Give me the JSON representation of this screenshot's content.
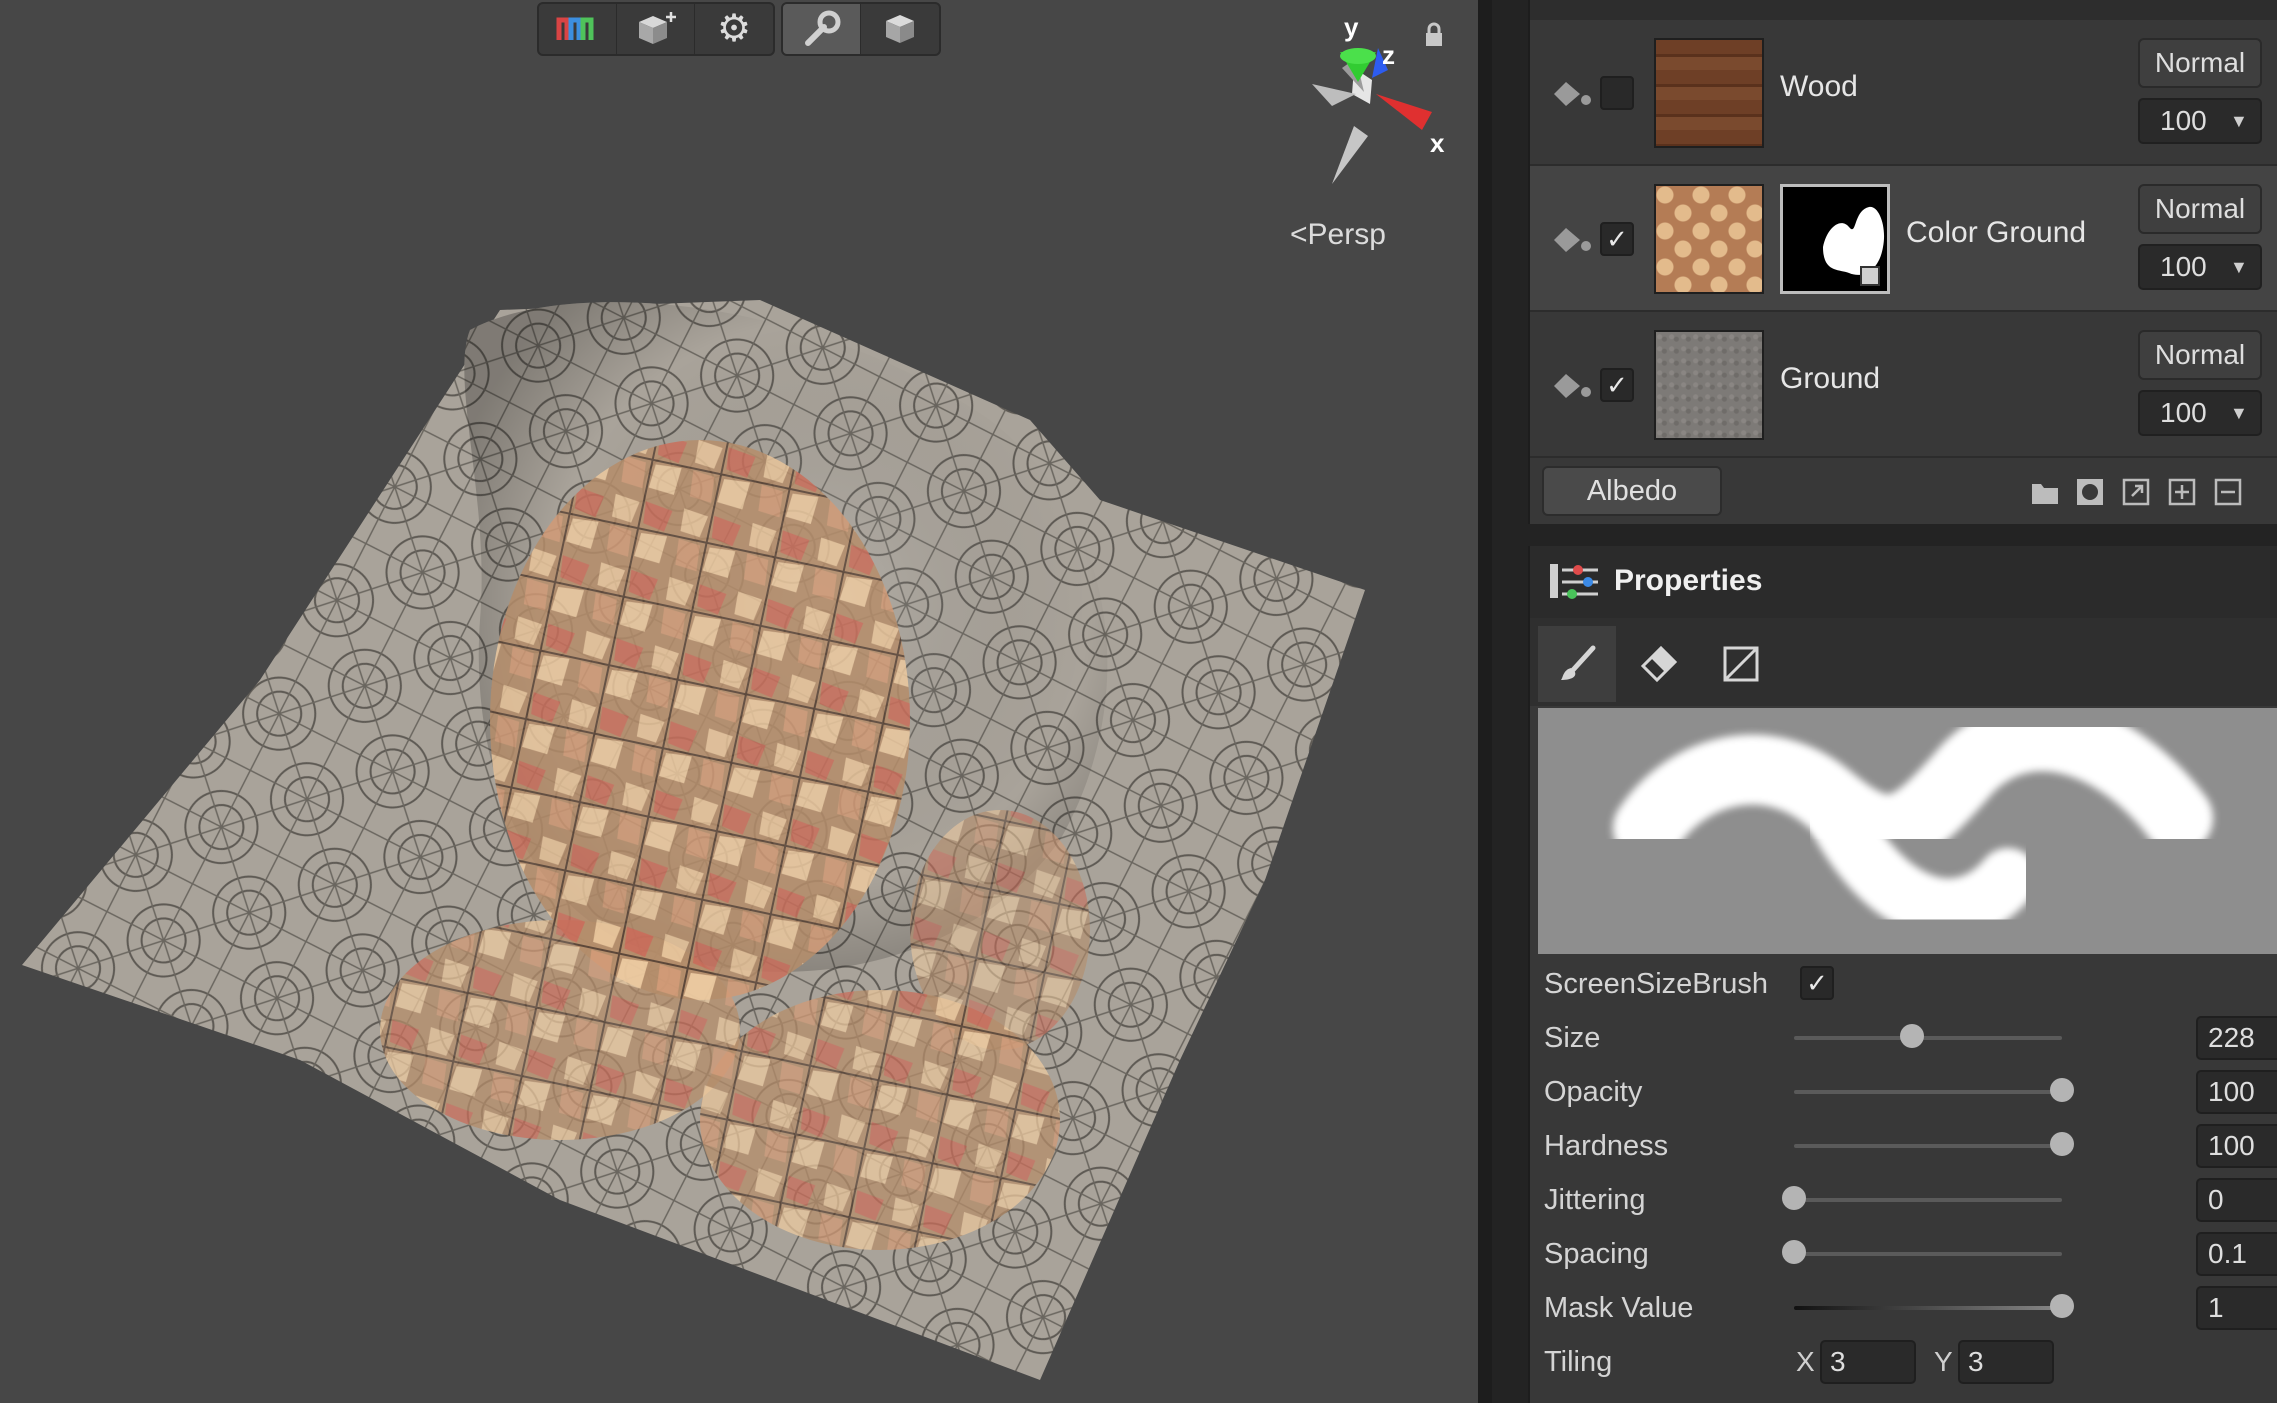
{
  "scene": {
    "persp_label": "Persp",
    "gizmo": {
      "x": "x",
      "y": "y",
      "z": "z"
    },
    "toolbar": [
      "unwrap-logo-icon",
      "add-object-icon",
      "gear-icon",
      "wrench-icon",
      "cube-icon"
    ]
  },
  "layers": {
    "items": [
      {
        "name": "Wood",
        "blend": "Normal",
        "opacity": "100",
        "visible": false
      },
      {
        "name": "Color Ground",
        "blend": "Normal",
        "opacity": "100",
        "visible": true
      },
      {
        "name": "Ground",
        "blend": "Normal",
        "opacity": "100",
        "visible": true
      }
    ],
    "channel": "Albedo"
  },
  "properties": {
    "title": "Properties",
    "rows": [
      {
        "label": "ScreenSizeBrush",
        "checked": true
      },
      {
        "label": "Size",
        "value": "228",
        "level": 0.44
      },
      {
        "label": "Opacity",
        "value": "100",
        "level": 1.0
      },
      {
        "label": "Hardness",
        "value": "100",
        "level": 1.0
      },
      {
        "label": "Jittering",
        "value": "0",
        "level": 0.0
      },
      {
        "label": "Spacing",
        "value": "0.1",
        "level": 0.0
      },
      {
        "label": "Mask Value",
        "value": "1",
        "level": 1.0
      }
    ],
    "tiling": {
      "label": "Tiling",
      "x_label": "X",
      "x": "3",
      "y_label": "Y",
      "y": "3"
    }
  },
  "colors": {
    "accent_red": "#e04040",
    "gizmo_green": "#33cc33",
    "gizmo_blue": "#3366ff"
  }
}
